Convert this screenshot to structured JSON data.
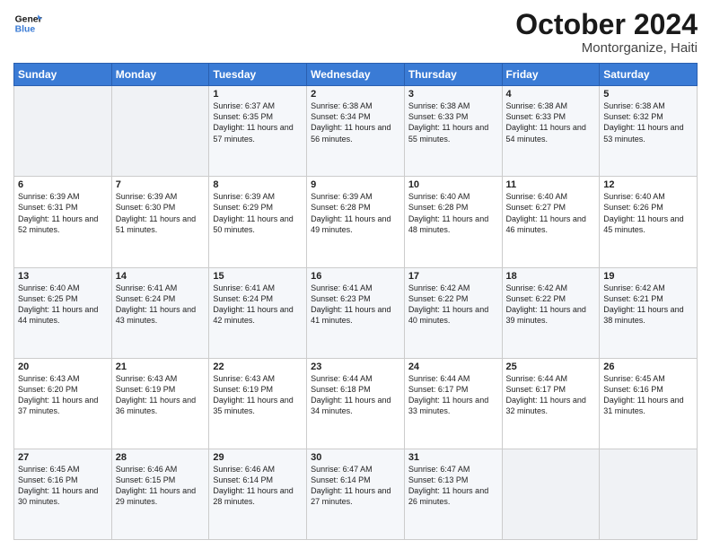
{
  "logo": {
    "text_general": "General",
    "text_blue": "Blue"
  },
  "header": {
    "month": "October 2024",
    "location": "Montorganize, Haiti"
  },
  "weekdays": [
    "Sunday",
    "Monday",
    "Tuesday",
    "Wednesday",
    "Thursday",
    "Friday",
    "Saturday"
  ],
  "weeks": [
    [
      {
        "day": "",
        "sunrise": "",
        "sunset": "",
        "daylight": ""
      },
      {
        "day": "",
        "sunrise": "",
        "sunset": "",
        "daylight": ""
      },
      {
        "day": "1",
        "sunrise": "Sunrise: 6:37 AM",
        "sunset": "Sunset: 6:35 PM",
        "daylight": "Daylight: 11 hours and 57 minutes."
      },
      {
        "day": "2",
        "sunrise": "Sunrise: 6:38 AM",
        "sunset": "Sunset: 6:34 PM",
        "daylight": "Daylight: 11 hours and 56 minutes."
      },
      {
        "day": "3",
        "sunrise": "Sunrise: 6:38 AM",
        "sunset": "Sunset: 6:33 PM",
        "daylight": "Daylight: 11 hours and 55 minutes."
      },
      {
        "day": "4",
        "sunrise": "Sunrise: 6:38 AM",
        "sunset": "Sunset: 6:33 PM",
        "daylight": "Daylight: 11 hours and 54 minutes."
      },
      {
        "day": "5",
        "sunrise": "Sunrise: 6:38 AM",
        "sunset": "Sunset: 6:32 PM",
        "daylight": "Daylight: 11 hours and 53 minutes."
      }
    ],
    [
      {
        "day": "6",
        "sunrise": "Sunrise: 6:39 AM",
        "sunset": "Sunset: 6:31 PM",
        "daylight": "Daylight: 11 hours and 52 minutes."
      },
      {
        "day": "7",
        "sunrise": "Sunrise: 6:39 AM",
        "sunset": "Sunset: 6:30 PM",
        "daylight": "Daylight: 11 hours and 51 minutes."
      },
      {
        "day": "8",
        "sunrise": "Sunrise: 6:39 AM",
        "sunset": "Sunset: 6:29 PM",
        "daylight": "Daylight: 11 hours and 50 minutes."
      },
      {
        "day": "9",
        "sunrise": "Sunrise: 6:39 AM",
        "sunset": "Sunset: 6:28 PM",
        "daylight": "Daylight: 11 hours and 49 minutes."
      },
      {
        "day": "10",
        "sunrise": "Sunrise: 6:40 AM",
        "sunset": "Sunset: 6:28 PM",
        "daylight": "Daylight: 11 hours and 48 minutes."
      },
      {
        "day": "11",
        "sunrise": "Sunrise: 6:40 AM",
        "sunset": "Sunset: 6:27 PM",
        "daylight": "Daylight: 11 hours and 46 minutes."
      },
      {
        "day": "12",
        "sunrise": "Sunrise: 6:40 AM",
        "sunset": "Sunset: 6:26 PM",
        "daylight": "Daylight: 11 hours and 45 minutes."
      }
    ],
    [
      {
        "day": "13",
        "sunrise": "Sunrise: 6:40 AM",
        "sunset": "Sunset: 6:25 PM",
        "daylight": "Daylight: 11 hours and 44 minutes."
      },
      {
        "day": "14",
        "sunrise": "Sunrise: 6:41 AM",
        "sunset": "Sunset: 6:24 PM",
        "daylight": "Daylight: 11 hours and 43 minutes."
      },
      {
        "day": "15",
        "sunrise": "Sunrise: 6:41 AM",
        "sunset": "Sunset: 6:24 PM",
        "daylight": "Daylight: 11 hours and 42 minutes."
      },
      {
        "day": "16",
        "sunrise": "Sunrise: 6:41 AM",
        "sunset": "Sunset: 6:23 PM",
        "daylight": "Daylight: 11 hours and 41 minutes."
      },
      {
        "day": "17",
        "sunrise": "Sunrise: 6:42 AM",
        "sunset": "Sunset: 6:22 PM",
        "daylight": "Daylight: 11 hours and 40 minutes."
      },
      {
        "day": "18",
        "sunrise": "Sunrise: 6:42 AM",
        "sunset": "Sunset: 6:22 PM",
        "daylight": "Daylight: 11 hours and 39 minutes."
      },
      {
        "day": "19",
        "sunrise": "Sunrise: 6:42 AM",
        "sunset": "Sunset: 6:21 PM",
        "daylight": "Daylight: 11 hours and 38 minutes."
      }
    ],
    [
      {
        "day": "20",
        "sunrise": "Sunrise: 6:43 AM",
        "sunset": "Sunset: 6:20 PM",
        "daylight": "Daylight: 11 hours and 37 minutes."
      },
      {
        "day": "21",
        "sunrise": "Sunrise: 6:43 AM",
        "sunset": "Sunset: 6:19 PM",
        "daylight": "Daylight: 11 hours and 36 minutes."
      },
      {
        "day": "22",
        "sunrise": "Sunrise: 6:43 AM",
        "sunset": "Sunset: 6:19 PM",
        "daylight": "Daylight: 11 hours and 35 minutes."
      },
      {
        "day": "23",
        "sunrise": "Sunrise: 6:44 AM",
        "sunset": "Sunset: 6:18 PM",
        "daylight": "Daylight: 11 hours and 34 minutes."
      },
      {
        "day": "24",
        "sunrise": "Sunrise: 6:44 AM",
        "sunset": "Sunset: 6:17 PM",
        "daylight": "Daylight: 11 hours and 33 minutes."
      },
      {
        "day": "25",
        "sunrise": "Sunrise: 6:44 AM",
        "sunset": "Sunset: 6:17 PM",
        "daylight": "Daylight: 11 hours and 32 minutes."
      },
      {
        "day": "26",
        "sunrise": "Sunrise: 6:45 AM",
        "sunset": "Sunset: 6:16 PM",
        "daylight": "Daylight: 11 hours and 31 minutes."
      }
    ],
    [
      {
        "day": "27",
        "sunrise": "Sunrise: 6:45 AM",
        "sunset": "Sunset: 6:16 PM",
        "daylight": "Daylight: 11 hours and 30 minutes."
      },
      {
        "day": "28",
        "sunrise": "Sunrise: 6:46 AM",
        "sunset": "Sunset: 6:15 PM",
        "daylight": "Daylight: 11 hours and 29 minutes."
      },
      {
        "day": "29",
        "sunrise": "Sunrise: 6:46 AM",
        "sunset": "Sunset: 6:14 PM",
        "daylight": "Daylight: 11 hours and 28 minutes."
      },
      {
        "day": "30",
        "sunrise": "Sunrise: 6:47 AM",
        "sunset": "Sunset: 6:14 PM",
        "daylight": "Daylight: 11 hours and 27 minutes."
      },
      {
        "day": "31",
        "sunrise": "Sunrise: 6:47 AM",
        "sunset": "Sunset: 6:13 PM",
        "daylight": "Daylight: 11 hours and 26 minutes."
      },
      {
        "day": "",
        "sunrise": "",
        "sunset": "",
        "daylight": ""
      },
      {
        "day": "",
        "sunrise": "",
        "sunset": "",
        "daylight": ""
      }
    ]
  ]
}
